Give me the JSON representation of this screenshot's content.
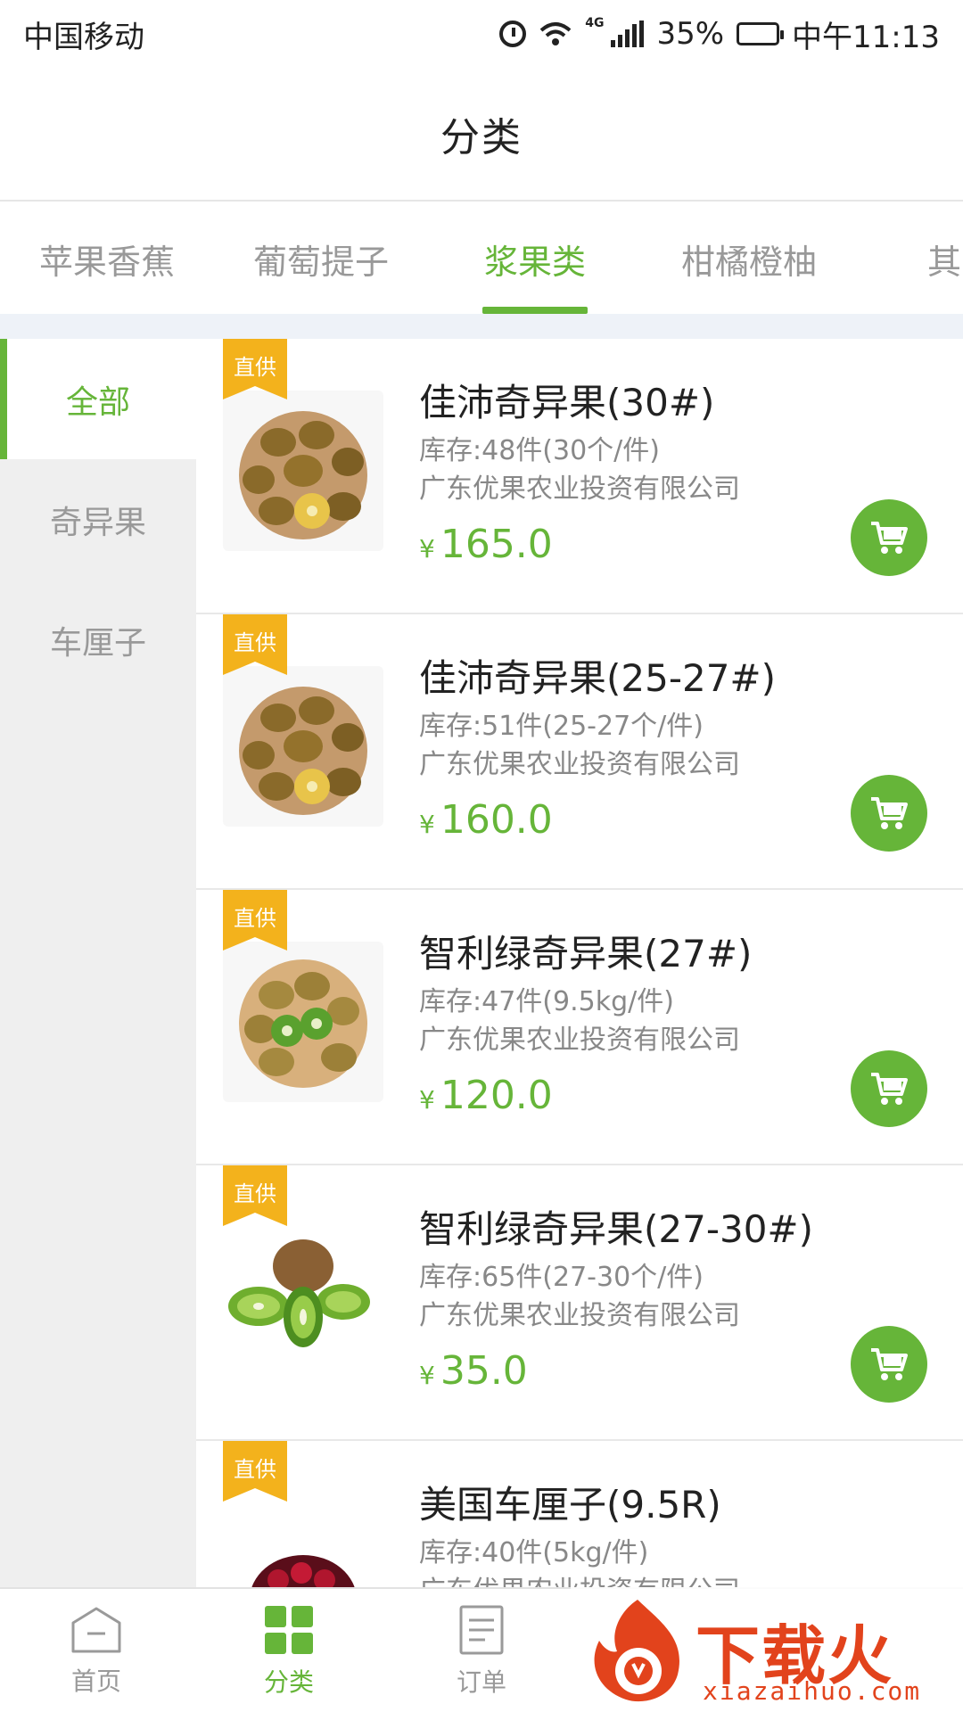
{
  "status_bar": {
    "carrier": "中国移动",
    "network": "4G",
    "battery": "35%",
    "time": "中午11:13"
  },
  "header": {
    "title": "分类"
  },
  "tabs": [
    {
      "label": "苹果香蕉",
      "active": false
    },
    {
      "label": "葡萄提子",
      "active": false
    },
    {
      "label": "浆果类",
      "active": true
    },
    {
      "label": "柑橘橙柚",
      "active": false
    },
    {
      "label": "其",
      "active": false
    }
  ],
  "sidebar": {
    "items": [
      {
        "label": "全部",
        "active": true
      },
      {
        "label": "奇异果",
        "active": false
      },
      {
        "label": "车厘子",
        "active": false
      }
    ]
  },
  "products": [
    {
      "badge": "直供",
      "name": "佳沛奇异果(30#)",
      "stock": "库存:48件(30个/件)",
      "supplier": "广东优果农业投资有限公司",
      "currency": "¥",
      "price": "165.0",
      "image": "golden-kiwi-basket"
    },
    {
      "badge": "直供",
      "name": "佳沛奇异果(25-27#)",
      "stock": "库存:51件(25-27个/件)",
      "supplier": "广东优果农业投资有限公司",
      "currency": "¥",
      "price": "160.0",
      "image": "golden-kiwi-basket"
    },
    {
      "badge": "直供",
      "name": "智利绿奇异果(27#)",
      "stock": "库存:47件(9.5kg/件)",
      "supplier": "广东优果农业投资有限公司",
      "currency": "¥",
      "price": "120.0",
      "image": "green-kiwi-basket"
    },
    {
      "badge": "直供",
      "name": "智利绿奇异果(27-30#)",
      "stock": "库存:65件(27-30个/件)",
      "supplier": "广东优果农业投资有限公司",
      "currency": "¥",
      "price": "35.0",
      "image": "kiwi-halves"
    },
    {
      "badge": "直供",
      "name": "美国车厘子(9.5R)",
      "stock": "库存:40件(5kg/件)",
      "supplier": "广东优果农业投资有限公司",
      "currency": "¥",
      "price": "",
      "image": "cherries-bowl"
    }
  ],
  "bottom_nav": [
    {
      "label": "首页",
      "icon": "home-icon",
      "active": false
    },
    {
      "label": "分类",
      "icon": "grid-icon",
      "active": true
    },
    {
      "label": "订单",
      "icon": "order-icon",
      "active": false
    }
  ],
  "watermark": {
    "text": "下载火",
    "url": "xiazaihuo.com"
  },
  "colors": {
    "accent": "#66b539",
    "badge": "#f3b21c",
    "watermark": "#e2431c"
  }
}
